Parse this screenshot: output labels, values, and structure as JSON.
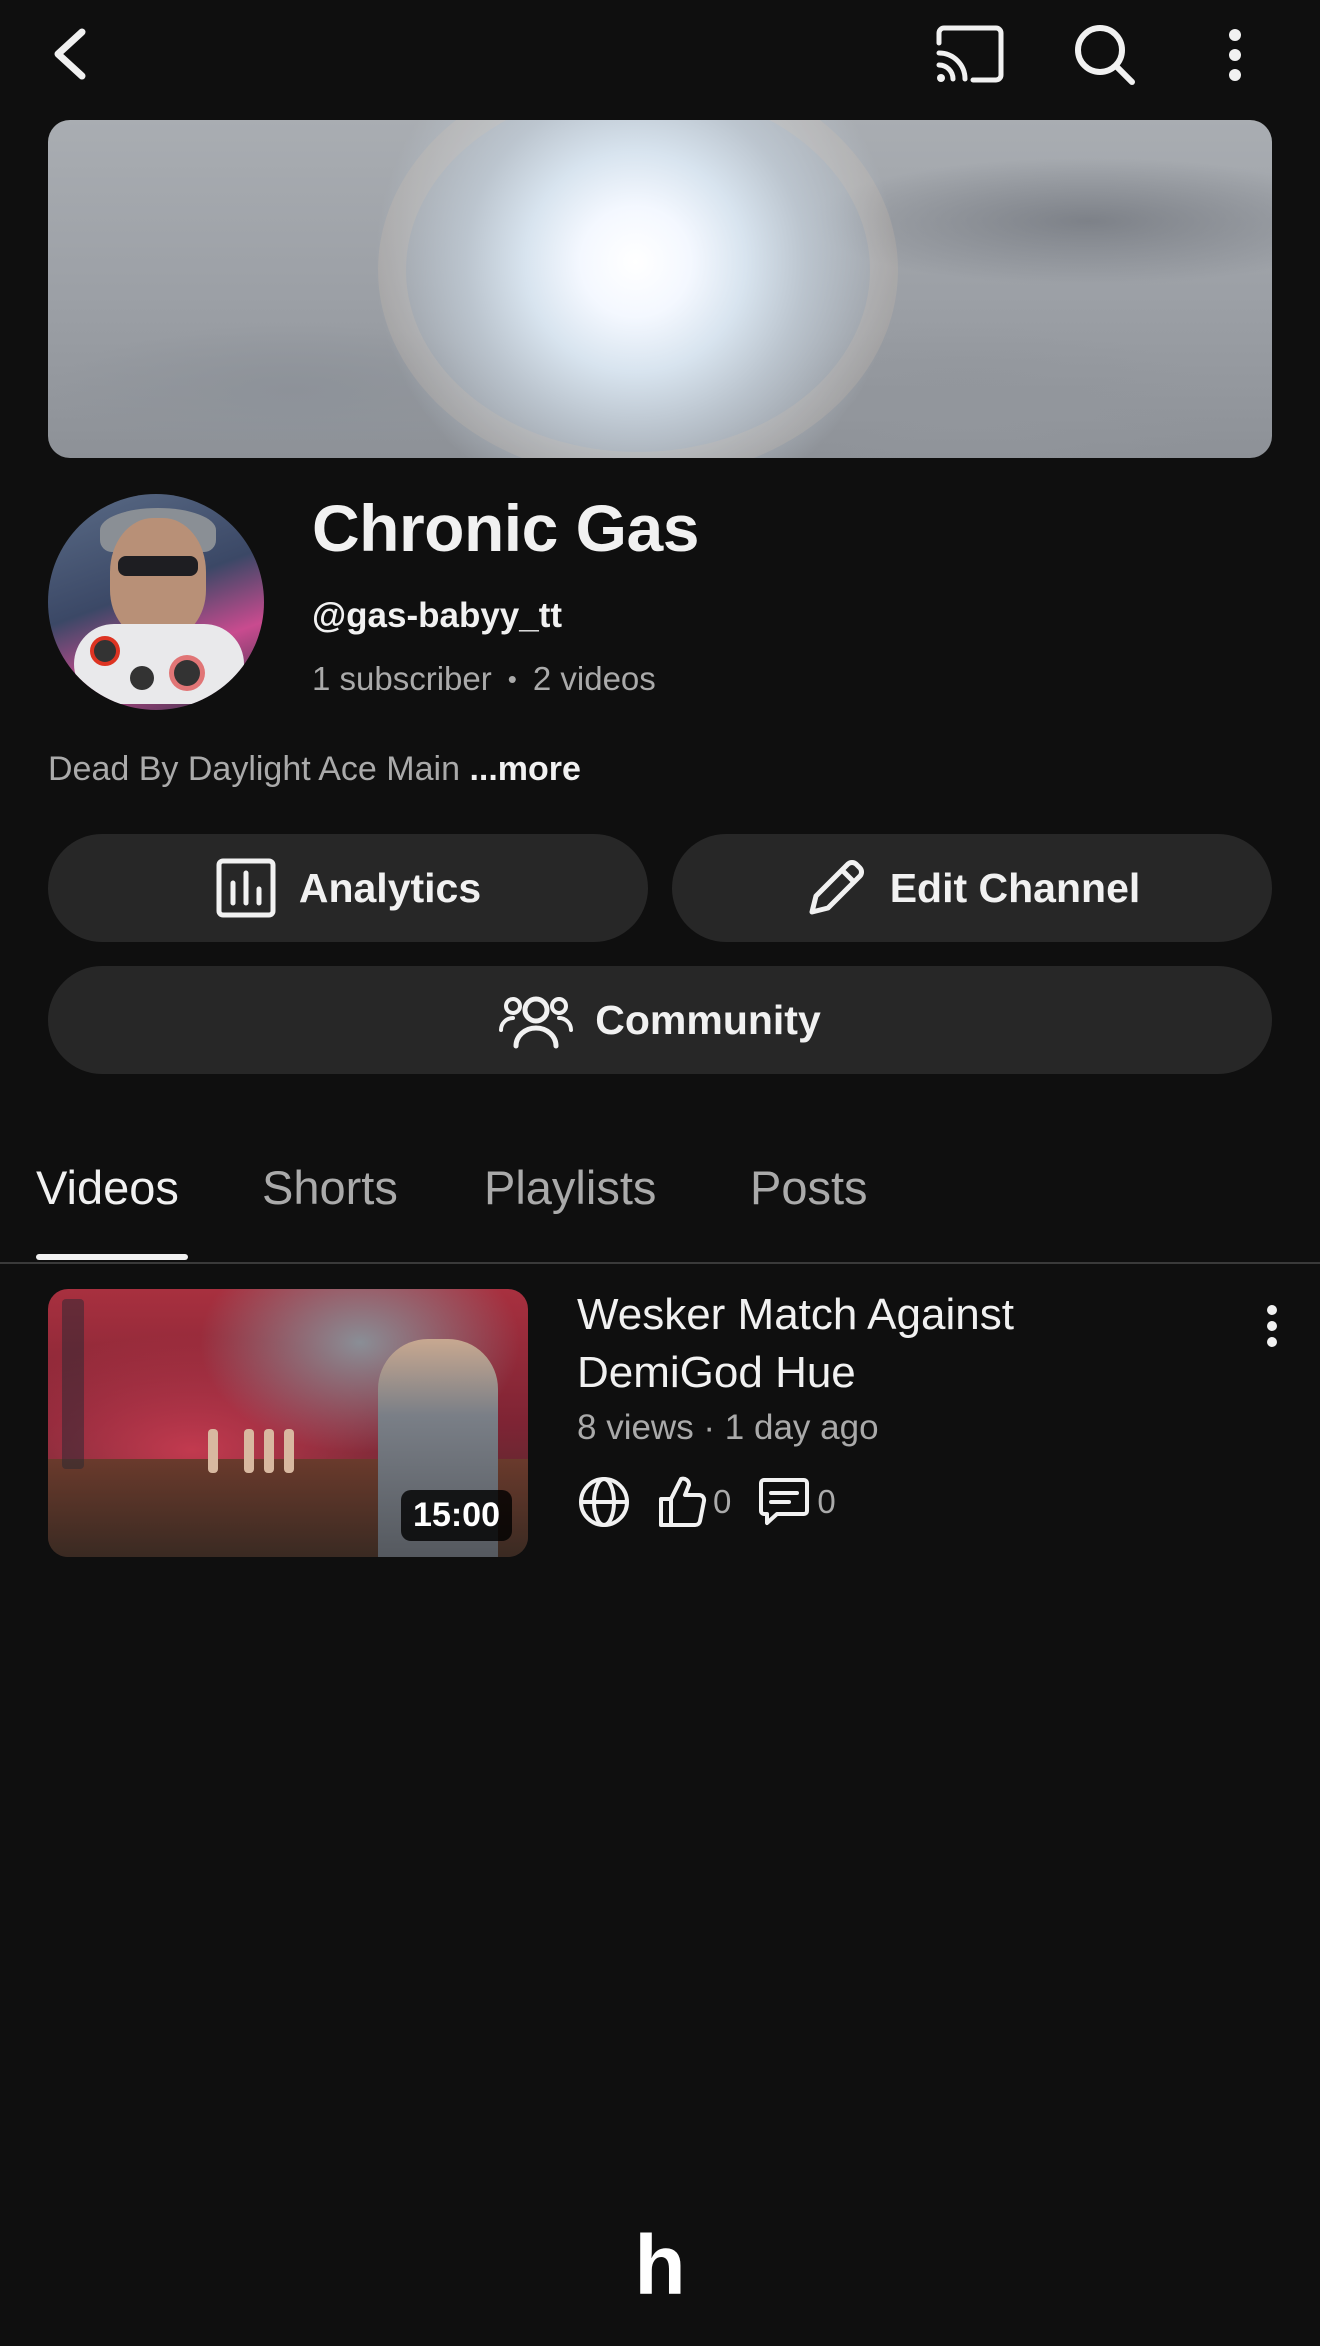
{
  "topbar": {
    "icons": [
      "back-icon",
      "cast-icon",
      "search-icon",
      "more-vertical-icon"
    ]
  },
  "channel": {
    "name": "Chronic Gas",
    "handle": "@gas-babyy_tt",
    "subscribers": "1 subscriber",
    "separator": "•",
    "videos_count": "2 videos",
    "description": "Dead By Daylight Ace Main ",
    "more_label": "...more"
  },
  "actions": {
    "analytics": "Analytics",
    "edit_channel": "Edit Channel",
    "community": "Community"
  },
  "tabs": [
    {
      "label": "Videos",
      "active": true
    },
    {
      "label": "Shorts",
      "active": false
    },
    {
      "label": "Playlists",
      "active": false
    },
    {
      "label": "Posts",
      "active": false
    }
  ],
  "videos": [
    {
      "title": "Wesker Match Against DemiGod Hue",
      "meta": "8 views · 1 day ago",
      "duration": "15:00",
      "likes": "0",
      "comments": "0",
      "visibility_icon": "globe-icon"
    }
  ],
  "bottom_logo": "h",
  "colors": {
    "background": "#0f0f0f",
    "pill": "#272727",
    "text_primary": "#f1f1f1",
    "text_secondary": "#aaaaaa"
  }
}
